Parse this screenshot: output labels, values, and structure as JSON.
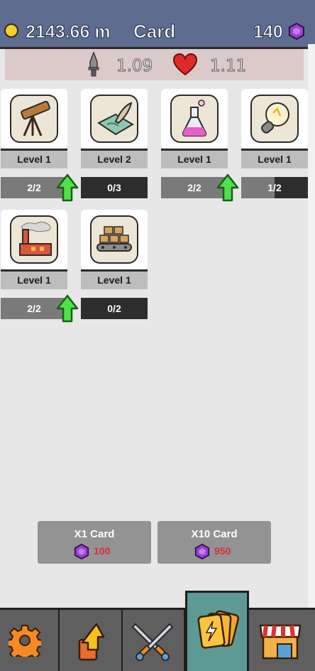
{
  "header": {
    "distance": "2143.66 m",
    "title": "Card",
    "gems": "140"
  },
  "stats": {
    "attack": "1.09",
    "health": "1.11"
  },
  "cards": [
    {
      "icon": "telescope-icon",
      "level": "Level 1",
      "progress": "2/2",
      "fill": 1.0,
      "upgrade": true
    },
    {
      "icon": "map-quill-icon",
      "level": "Level 2",
      "progress": "0/3",
      "fill": 0.0,
      "upgrade": false
    },
    {
      "icon": "potion-flask-icon",
      "level": "Level 1",
      "progress": "2/2",
      "fill": 1.0,
      "upgrade": true
    },
    {
      "icon": "lightbulb-icon",
      "level": "Level 1",
      "progress": "1/2",
      "fill": 0.5,
      "upgrade": false
    },
    {
      "icon": "factory-icon",
      "level": "Level 1",
      "progress": "2/2",
      "fill": 1.0,
      "upgrade": true
    },
    {
      "icon": "conveyor-boxes-icon",
      "level": "Level 1",
      "progress": "0/2",
      "fill": 0.0,
      "upgrade": false
    }
  ],
  "buy": {
    "x1_label": "X1 Card",
    "x1_price": "100",
    "x10_label": "X10 Card",
    "x10_price": "950"
  },
  "colors": {
    "header_bg": "#5d6c8f",
    "active_tab": "#5e9a94",
    "price_red": "#d6303a",
    "gem_purple": "#9b3fd6",
    "upgrade_green": "#4fe04a"
  },
  "nav": [
    "gear-icon",
    "upgrade-arrow-icon",
    "crossed-swords-icon",
    "cards-icon",
    "shop-icon"
  ]
}
